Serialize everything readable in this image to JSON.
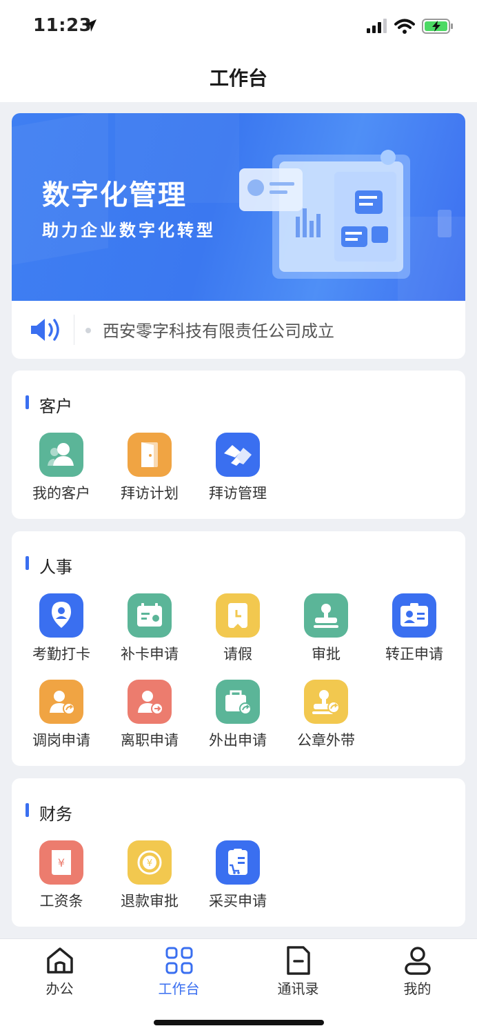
{
  "status_bar": {
    "time": "11:23"
  },
  "header": {
    "title": "工作台"
  },
  "banner": {
    "title": "数字化管理",
    "subtitle": "助力企业数字化转型"
  },
  "notice": {
    "text": "西安零字科技有限责任公司成立"
  },
  "sections": [
    {
      "title": "客户",
      "items": [
        {
          "label": "我的客户",
          "icon": "customer-icon",
          "color": "#5bb598"
        },
        {
          "label": "拜访计划",
          "icon": "door-icon",
          "color": "#f0a443"
        },
        {
          "label": "拜访管理",
          "icon": "handshake-icon",
          "color": "#3a6ff0"
        }
      ]
    },
    {
      "title": "人事",
      "items": [
        {
          "label": "考勤打卡",
          "icon": "location-pin-icon",
          "color": "#3a6ff0"
        },
        {
          "label": "补卡申请",
          "icon": "card-icon",
          "color": "#5bb598"
        },
        {
          "label": "请假",
          "icon": "clock-doc-icon",
          "color": "#f2c84f"
        },
        {
          "label": "审批",
          "icon": "stamp-icon",
          "color": "#5bb598"
        },
        {
          "label": "转正申请",
          "icon": "id-card-icon",
          "color": "#3a6ff0"
        },
        {
          "label": "调岗申请",
          "icon": "user-transfer-icon",
          "color": "#f0a443"
        },
        {
          "label": "离职申请",
          "icon": "user-leave-icon",
          "color": "#ec7c6e"
        },
        {
          "label": "外出申请",
          "icon": "briefcase-out-icon",
          "color": "#5bb598"
        },
        {
          "label": "公章外带",
          "icon": "seal-out-icon",
          "color": "#f2c84f"
        }
      ]
    },
    {
      "title": "财务",
      "items": [
        {
          "label": "工资条",
          "icon": "salary-slip-icon",
          "color": "#ec7c6e"
        },
        {
          "label": "退款审批",
          "icon": "refund-icon",
          "color": "#f2c84f"
        },
        {
          "label": "采买申请",
          "icon": "purchase-icon",
          "color": "#3a6ff0"
        }
      ]
    }
  ],
  "tabbar": {
    "items": [
      {
        "label": "办公",
        "icon": "home-icon"
      },
      {
        "label": "工作台",
        "icon": "grid-icon",
        "active": true
      },
      {
        "label": "通讯录",
        "icon": "contacts-icon"
      },
      {
        "label": "我的",
        "icon": "user-icon"
      }
    ]
  },
  "colors": {
    "accent": "#3a6ff0",
    "background": "#eef0f4"
  }
}
